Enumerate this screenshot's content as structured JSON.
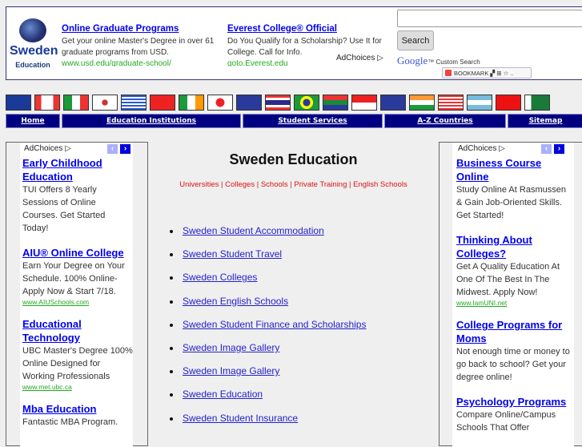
{
  "logo": {
    "title": "Sweden",
    "subtitle": "Education"
  },
  "top_ads": [
    {
      "title": "Online Graduate Programs",
      "desc": "Get your online Master's Degree in over 61 graduate programs from USD.",
      "url": "www.usd.edu/graduate-school/"
    },
    {
      "title": "Everest College® Official",
      "desc": "Do You Qualify for a Scholarship? Use It for College. Call for Info.",
      "url": "goto.Everest.edu"
    }
  ],
  "adchoices": "AdChoices ▷",
  "search": {
    "value": "",
    "button": "Search",
    "google": "Google",
    "custom": "™ Custom Search",
    "bookmark": "BOOKMARK"
  },
  "flags": [
    "australia",
    "canada",
    "italy",
    "south-korea",
    "greece",
    "china",
    "ireland",
    "japan",
    "new-zealand",
    "thailand",
    "brazil",
    "south-africa",
    "singapore",
    "uk",
    "india",
    "usa",
    "argentina",
    "hong-kong",
    "pakistan"
  ],
  "nav": [
    "Home",
    "Education Institutions",
    "Student Services",
    "A-Z  Countries",
    "Sitemap"
  ],
  "left_ads": [
    {
      "title": "Early Childhood Education",
      "desc": "TUI Offers 8 Yearly Sessions of Online Courses. Get Started Today!",
      "url": ""
    },
    {
      "title": "AIU® Online College",
      "desc": "Earn Your Degree on Your Schedule. 100% Online- Apply Now & Start 7/18.",
      "url": "www.AIUSchools.com"
    },
    {
      "title": "Educational Technology",
      "desc": "UBC Master's Degree 100% Online Designed for Working Professionals",
      "url": "www.met.ubc.ca"
    },
    {
      "title": "Mba Education",
      "desc": "Fantastic MBA Program.",
      "url": ""
    }
  ],
  "right_ads": [
    {
      "title": "Business Course Online",
      "desc": "Study Online At Rasmussen & Gain Job-Oriented Skills. Get Started!",
      "url": ""
    },
    {
      "title": "Thinking About Colleges?",
      "desc": "Get A Quality Education At One Of The Best In The Midwest. Apply Now!",
      "url": "www.IamUNI.net"
    },
    {
      "title": "College Programs for Moms",
      "desc": "Not enough time or money to go back to school? Get your degree online!",
      "url": ""
    },
    {
      "title": "Psychology Programs",
      "desc": "Compare Online/Campus Schools That Offer",
      "url": ""
    }
  ],
  "main": {
    "title": "Sweden Education",
    "subtitle": "Universities | Colleges | Schools | Private Training | English Schools",
    "links": [
      "Sweden Student Accommodation",
      "Sweden Student Travel",
      "Sweden Colleges",
      "Sweden English Schools",
      "Sweden Student Finance and Scholarships",
      "Sweden Image Gallery",
      "Sweden Image Gallery",
      "Sweden Education",
      "Sweden Student Insurance"
    ]
  }
}
